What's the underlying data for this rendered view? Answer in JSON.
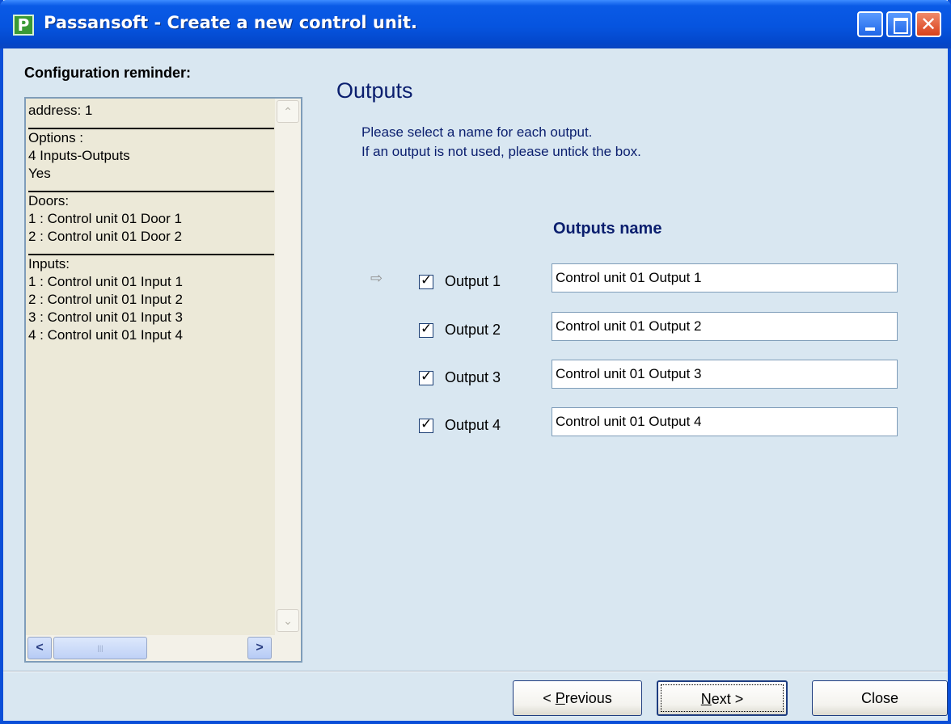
{
  "window": {
    "title": "Passansoft - Create a new control unit.",
    "app_icon_letter": "P",
    "close_glyph": "✕"
  },
  "sidebar": {
    "label": "Configuration reminder:",
    "sections": [
      {
        "lines": [
          "address: 1"
        ]
      },
      {
        "lines": [
          "Options :",
          "4 Inputs-Outputs",
          "Yes"
        ]
      },
      {
        "lines": [
          "Doors:",
          "1 : Control unit 01 Door 1",
          "2 : Control unit 01 Door 2"
        ]
      },
      {
        "lines": [
          "Inputs:",
          "1 : Control unit 01 Input 1",
          "2 : Control unit 01 Input 2",
          "3 : Control unit 01 Input 3",
          "4 : Control unit 01 Input 4"
        ]
      }
    ],
    "scroll_up_glyph": "⌃",
    "scroll_down_glyph": "⌄",
    "scroll_left_glyph": "<",
    "scroll_right_glyph": ">",
    "thumb_grip": "|||"
  },
  "main": {
    "title": "Outputs",
    "instruction_1": "Please select a name for each output.",
    "instruction_2": "If an output is not used, please untick the box.",
    "column_header": "Outputs name",
    "current_row_indicator": "⇨",
    "outputs": [
      {
        "label": "Output 1",
        "checked": true,
        "value": "Control unit 01 Output 1"
      },
      {
        "label": "Output 2",
        "checked": true,
        "value": "Control unit 01 Output 2"
      },
      {
        "label": "Output 3",
        "checked": true,
        "value": "Control unit 01 Output 3"
      },
      {
        "label": "Output 4",
        "checked": true,
        "value": "Control unit 01 Output 4"
      }
    ]
  },
  "footer": {
    "previous_prefix": "< ",
    "previous_accel": "P",
    "previous_rest": "revious",
    "next_accel": "N",
    "next_rest": "ext >",
    "close_label": "Close"
  }
}
